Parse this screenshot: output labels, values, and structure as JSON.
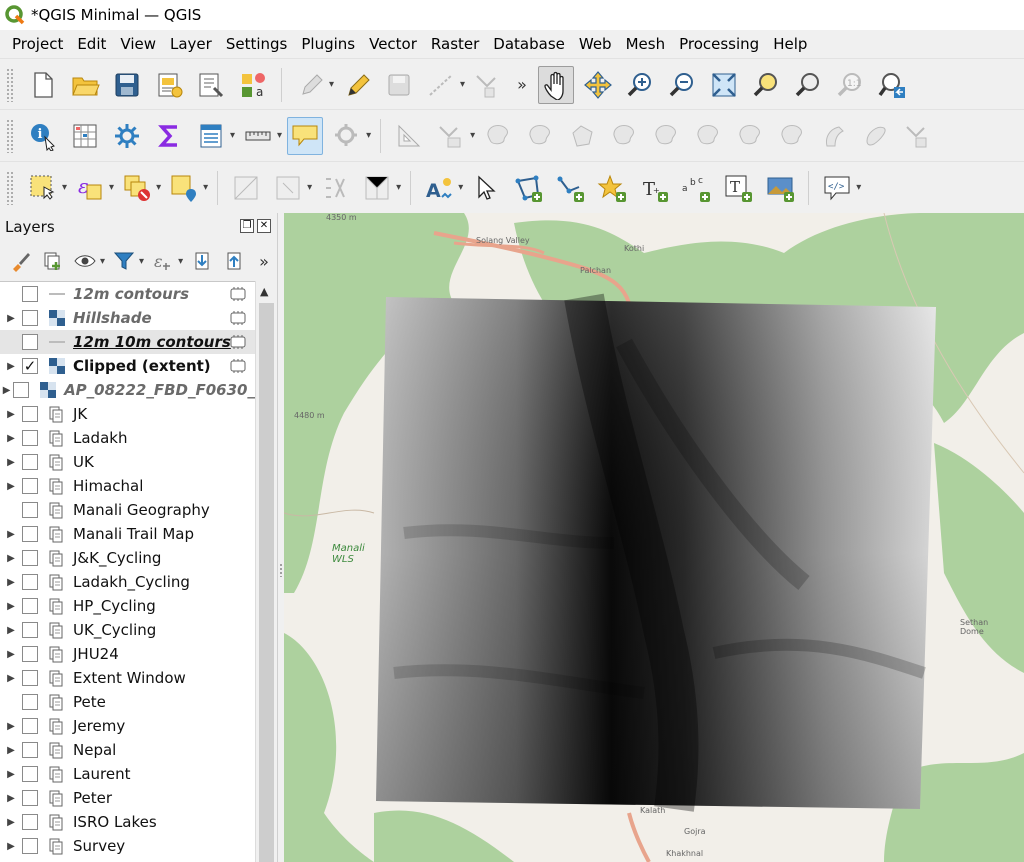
{
  "window": {
    "title": "*QGIS Minimal — QGIS"
  },
  "menu": [
    "Project",
    "Edit",
    "View",
    "Layer",
    "Settings",
    "Plugins",
    "Vector",
    "Raster",
    "Database",
    "Web",
    "Mesh",
    "Processing",
    "Help"
  ],
  "toolbars": {
    "overflow_symbol": "»"
  },
  "layers_panel": {
    "title": "Layers",
    "layers": [
      {
        "name": "12m contours",
        "checked": false,
        "expandable": false,
        "icon": "line-layer-icon",
        "style": "grey"
      },
      {
        "name": "Hillshade",
        "checked": false,
        "expandable": true,
        "icon": "raster-layer-icon",
        "style": "grey"
      },
      {
        "name": "12m 10m contours",
        "checked": false,
        "expandable": false,
        "icon": "line-layer-icon",
        "style": "underl"
      },
      {
        "name": "Clipped (extent)",
        "checked": true,
        "expandable": true,
        "icon": "raster-layer-icon",
        "style": "bold"
      },
      {
        "name": "AP_08222_FBD_F0630_",
        "checked": false,
        "expandable": true,
        "icon": "raster-layer-icon",
        "style": "grey"
      },
      {
        "name": "JK",
        "checked": false,
        "expandable": true,
        "icon": "group-icon",
        "style": "normal"
      },
      {
        "name": "Ladakh",
        "checked": false,
        "expandable": true,
        "icon": "group-icon",
        "style": "normal"
      },
      {
        "name": "UK",
        "checked": false,
        "expandable": true,
        "icon": "group-icon",
        "style": "normal"
      },
      {
        "name": "Himachal",
        "checked": false,
        "expandable": true,
        "icon": "group-icon",
        "style": "normal"
      },
      {
        "name": "Manali Geography",
        "checked": false,
        "expandable": false,
        "icon": "group-icon",
        "style": "normal"
      },
      {
        "name": "Manali Trail Map",
        "checked": false,
        "expandable": true,
        "icon": "group-icon",
        "style": "normal"
      },
      {
        "name": "J&K_Cycling",
        "checked": false,
        "expandable": true,
        "icon": "group-icon",
        "style": "normal"
      },
      {
        "name": "Ladakh_Cycling",
        "checked": false,
        "expandable": true,
        "icon": "group-icon",
        "style": "normal"
      },
      {
        "name": "HP_Cycling",
        "checked": false,
        "expandable": true,
        "icon": "group-icon",
        "style": "normal"
      },
      {
        "name": "UK_Cycling",
        "checked": false,
        "expandable": true,
        "icon": "group-icon",
        "style": "normal"
      },
      {
        "name": "JHU24",
        "checked": false,
        "expandable": true,
        "icon": "group-icon",
        "style": "normal"
      },
      {
        "name": "Extent Window",
        "checked": false,
        "expandable": true,
        "icon": "group-icon",
        "style": "normal"
      },
      {
        "name": "Pete",
        "checked": false,
        "expandable": false,
        "icon": "group-icon",
        "style": "normal"
      },
      {
        "name": "Jeremy",
        "checked": false,
        "expandable": true,
        "icon": "group-icon",
        "style": "normal"
      },
      {
        "name": "Nepal",
        "checked": false,
        "expandable": true,
        "icon": "group-icon",
        "style": "normal"
      },
      {
        "name": "Laurent",
        "checked": false,
        "expandable": true,
        "icon": "group-icon",
        "style": "normal"
      },
      {
        "name": "Peter",
        "checked": false,
        "expandable": true,
        "icon": "group-icon",
        "style": "normal"
      },
      {
        "name": "ISRO Lakes",
        "checked": false,
        "expandable": true,
        "icon": "group-icon",
        "style": "normal"
      },
      {
        "name": "Survey",
        "checked": false,
        "expandable": true,
        "icon": "group-icon",
        "style": "normal"
      }
    ]
  },
  "map": {
    "labels": {
      "elev1": "4350 m",
      "elev2": "4480 m",
      "solang": "Solang Valley",
      "kothi": "Kothi",
      "palchan": "Palchan",
      "manali_wls": "Manali\nWLS",
      "sethan": "Sethan\nDome",
      "kalath": "Kalath",
      "gojra": "Gojra",
      "khakhnal": "Khakhnal"
    },
    "colors": {
      "land": "#f2efe9",
      "forest": "#add19e",
      "road": "#e8a48c"
    }
  },
  "colors": {
    "accent": "#2f7fc1",
    "selection": "#e5e5e5"
  }
}
